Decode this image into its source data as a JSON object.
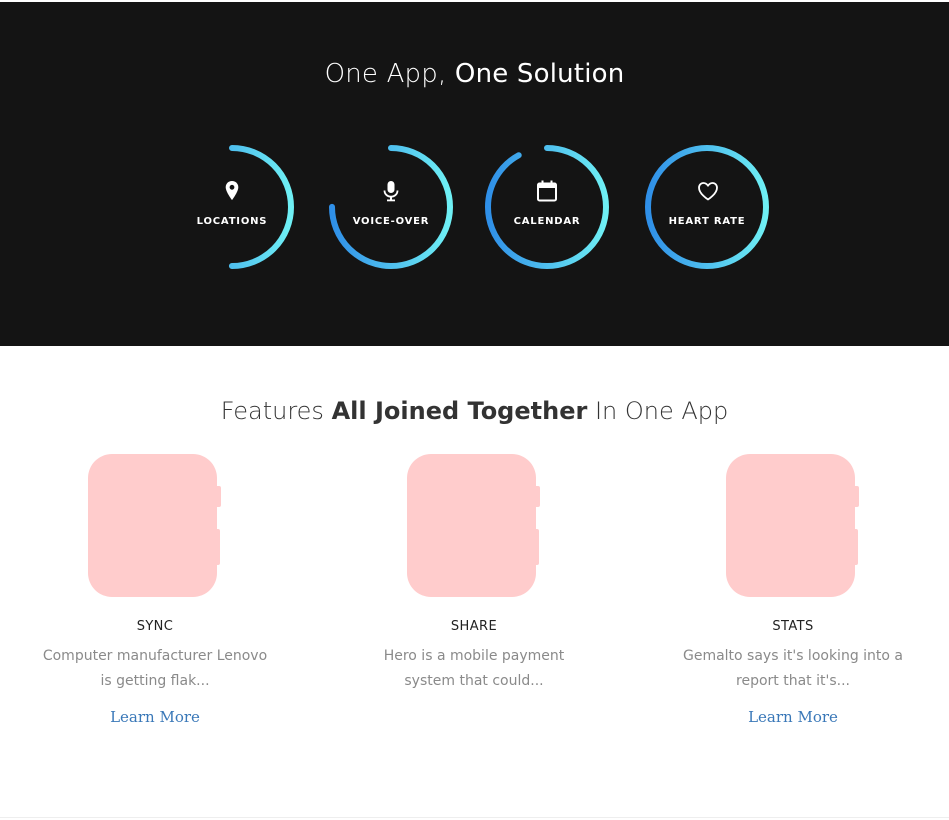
{
  "hero": {
    "title_light": "One App,",
    "title_bold": "One Solution",
    "rings": [
      {
        "label": "LOCATIONS",
        "icon": "map-pin-icon",
        "fill": 0.5
      },
      {
        "label": "VOICE-OVER",
        "icon": "microphone-icon",
        "fill": 0.75
      },
      {
        "label": "CALENDAR",
        "icon": "calendar-icon",
        "fill": 0.92
      },
      {
        "label": "HEART RATE",
        "icon": "heart-icon",
        "fill": 1.0
      }
    ],
    "colors": {
      "background": "#141414",
      "ring_start": "#2f8fe8",
      "ring_end": "#6ff0f5"
    }
  },
  "features": {
    "title_light_1": "Features",
    "title_bold": "All Joined Together",
    "title_light_2": "In One App",
    "items": [
      {
        "title": "SYNC",
        "text": "Computer manufacturer Lenovo is getting flak...",
        "link": "Learn More"
      },
      {
        "title": "SHARE",
        "text": "Hero is a mobile payment system that could...",
        "link": ""
      },
      {
        "title": "STATS",
        "text": "Gemalto says it's looking into a report that it's...",
        "link": "Learn More"
      }
    ],
    "colors": {
      "watch": "#ffcccc",
      "link": "#3a78b8"
    }
  }
}
